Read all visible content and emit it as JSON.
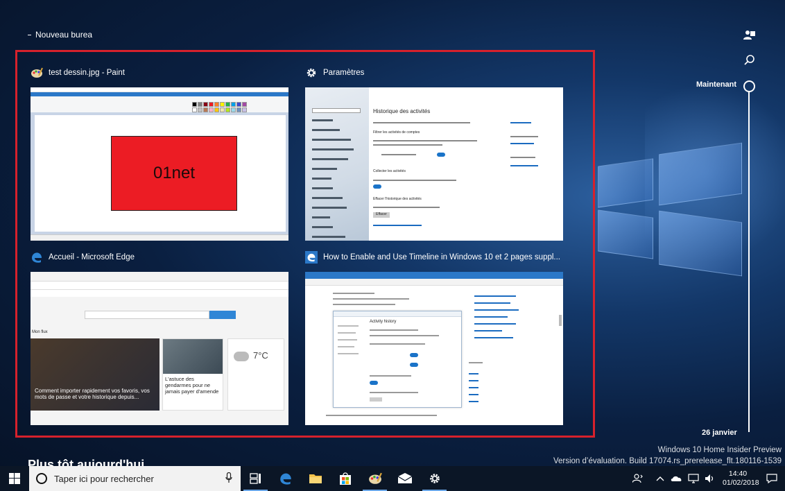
{
  "desktop": {
    "label": "Nouveau burea"
  },
  "windows": [
    {
      "title": "test dessin.jpg - Paint",
      "icon": "paint-icon",
      "canvas_text": "01net"
    },
    {
      "title": "Paramètres",
      "icon": "gear-icon",
      "page_title": "Historique des activités",
      "section1": "Filtrer les activités de comptes",
      "section2": "Collecter les activités",
      "section3": "Effacer l'historique des activités",
      "button": "Effacer"
    },
    {
      "title": "Accueil - Microsoft Edge",
      "icon": "edge-icon",
      "headline": "Comment importer rapidement vos favoris, vos mots de passe et votre historique depuis...",
      "card2": "L'astuce des gendarmes pour ne jamais payer d'amende",
      "weather_temp": "7°C",
      "section": "Mon flux"
    },
    {
      "title": "How to Enable and Use Timeline in Windows 10 et 2 pages suppl...",
      "icon": "edge-icon",
      "dialog_title": "Activity history"
    }
  ],
  "timeline": {
    "now_label": "Maintenant",
    "date_label": "26 janvier"
  },
  "earlier_label": "Plus tôt aujourd'hui",
  "watermark": {
    "line1": "Windows 10 Home Insider Preview",
    "line2": "Version d’évaluation. Build 17074.rs_prerelease_flt.180116-1539"
  },
  "taskbar": {
    "search_placeholder": "Taper ici pour rechercher",
    "time": "14:40",
    "date": "01/02/2018"
  },
  "colors": {
    "selection_border": "#d6212c",
    "accent": "#2b78c8"
  }
}
